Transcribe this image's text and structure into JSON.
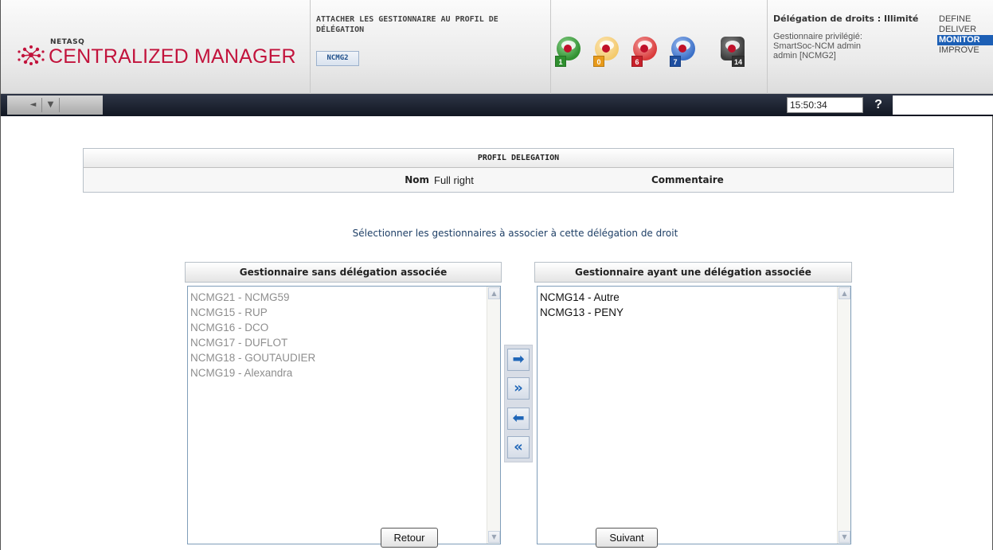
{
  "header": {
    "logo_brand": "NETASQ",
    "logo_product": "CENTRALIZED MANAGER",
    "page_title": "ATTACHER LES GESTIONNAIRE AU PROFIL DE DÉLÉGATION",
    "context_badge": "NCMG2",
    "status_icons": [
      {
        "name": "status-ok-icon",
        "count": "1",
        "badge_color": "#2f8f2f",
        "orb_color": "#3a9a3a"
      },
      {
        "name": "status-minor-icon",
        "count": "0",
        "badge_color": "#e89a1a",
        "orb_color": "#f4c96b"
      },
      {
        "name": "status-major-icon",
        "count": "6",
        "badge_color": "#c7202a",
        "orb_color": "#d93a3a"
      },
      {
        "name": "status-info-icon",
        "count": "7",
        "badge_color": "#1f4fa0",
        "orb_color": "#3a6fc7"
      },
      {
        "name": "status-unknown-icon",
        "count": "14",
        "badge_color": "#333333",
        "orb_color": "#3b3b3b"
      }
    ],
    "delegation": {
      "title": "Délégation de droits : Illimité",
      "line1": "Gestionnaire privilégié:",
      "line2": "SmartSoc-NCM admin",
      "line3": "admin [NCMG2]"
    },
    "modes": [
      "DEFINE",
      "DELIVER",
      "MONITOR",
      "IMPROVE"
    ],
    "active_mode": "MONITOR"
  },
  "toolbar": {
    "back_icon": "◄",
    "down_icon": "▼",
    "clock": "15:50:34",
    "help_label": "?"
  },
  "profil": {
    "title": "PROFIL DELEGATION",
    "nom_label": "Nom",
    "nom_value": "Full right",
    "commentaire_label": "Commentaire"
  },
  "instruction": "Sélectionner les gestionnaires à associer à cette délégation de droit",
  "left_list": {
    "header": "Gestionnaire sans délégation associée",
    "items": [
      "NCMG21 - NCMG59",
      "NCMG15 - RUP",
      "NCMG16 - DCO",
      "NCMG17 - DUFLOT",
      "NCMG18 - GOUTAUDIER",
      "NCMG19 - Alexandra"
    ]
  },
  "right_list": {
    "header": "Gestionnaire ayant une délégation associée",
    "items": [
      "NCMG14 - Autre",
      "NCMG13 - PENY"
    ]
  },
  "move_buttons": {
    "add": "➡",
    "add_all": "»",
    "remove": "⬅",
    "remove_all": "«"
  },
  "buttons": {
    "back": "Retour",
    "next": "Suivant"
  },
  "colors": {
    "brand_red": "#c2133c",
    "accent_blue": "#1c5fb5",
    "instruction_blue": "#1e3f66"
  }
}
